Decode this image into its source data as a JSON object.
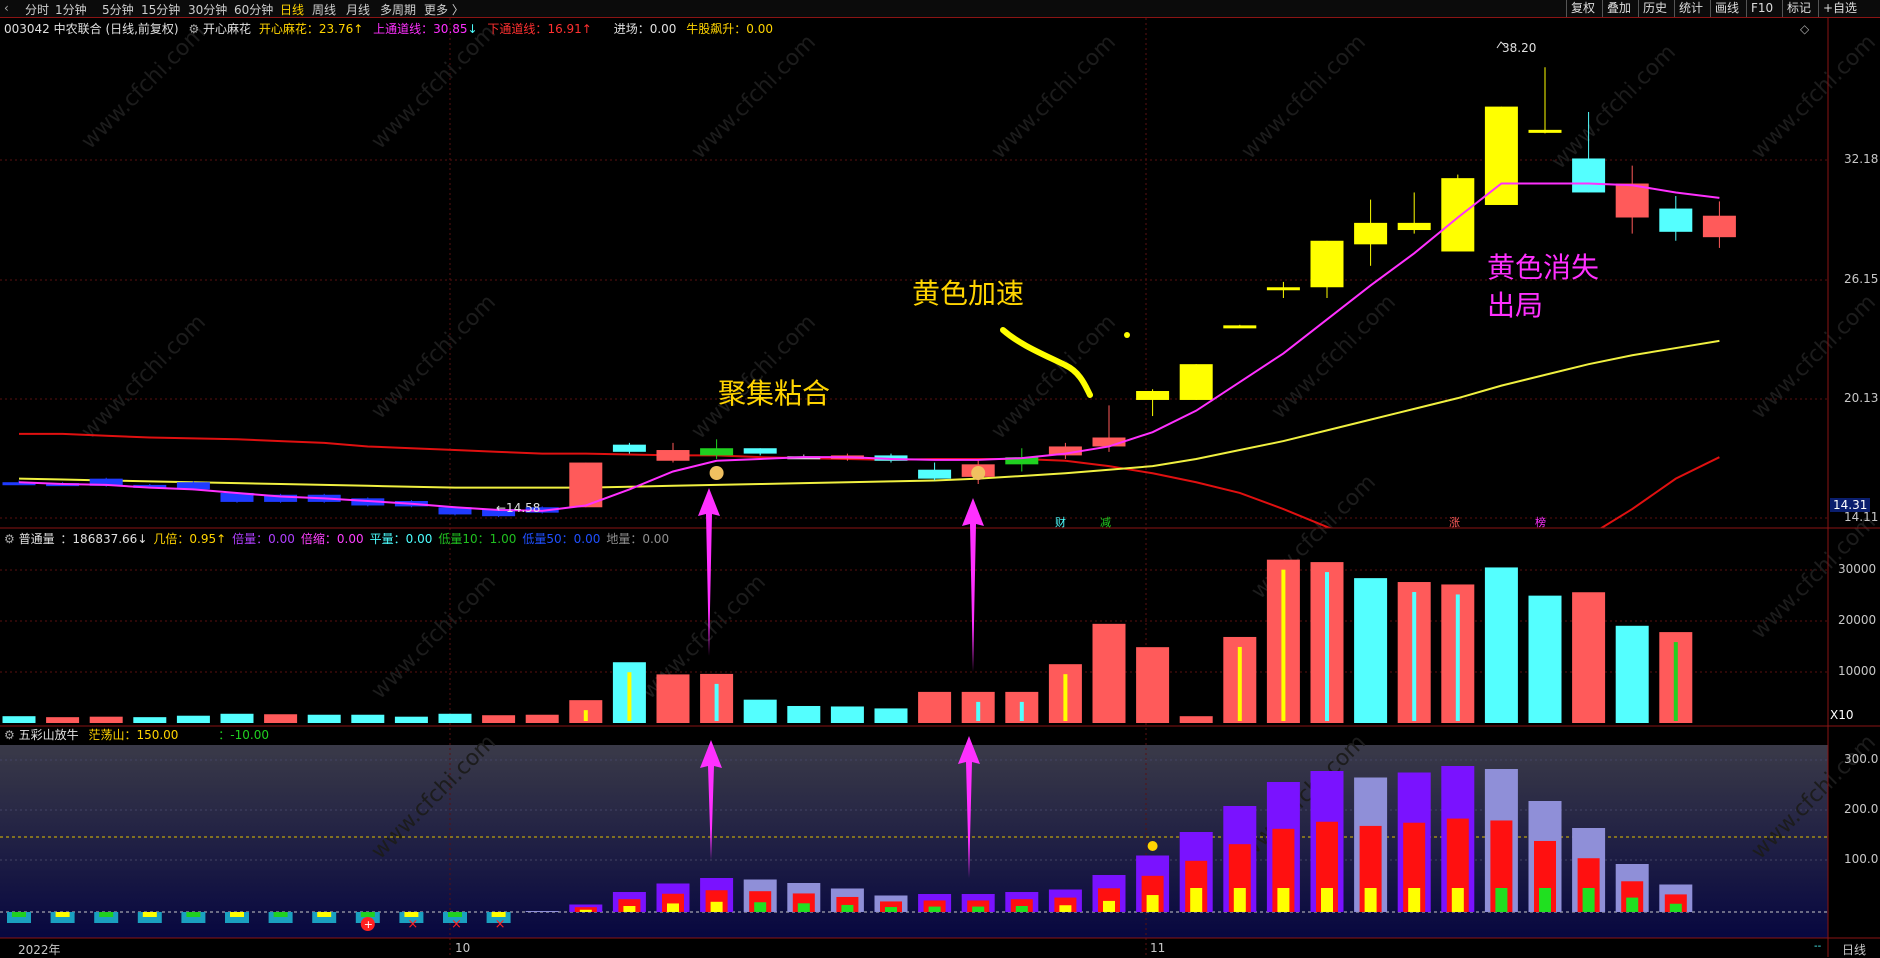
{
  "top_tabs": [
    "分时",
    "1分钟",
    "5分钟",
    "15分钟",
    "30分钟",
    "60分钟",
    "日线",
    "周线",
    "月线",
    "多周期",
    "更多 〉"
  ],
  "active_tab": "日线",
  "top_buttons": [
    "复权",
    "叠加",
    "历史",
    "统计",
    "画线",
    "F10",
    "标记",
    "+自选"
  ],
  "header": {
    "stock": "003042 中农联合 (日线,前复权)",
    "indicator_name": "开心麻花",
    "ind1_label": "开心麻花：",
    "ind1_value": "23.76",
    "ind1_arrow": "↑",
    "ind2_label": "上通道线：",
    "ind2_value": "30.85",
    "ind2_arrow": "↓",
    "ind3_label": "下通道线：",
    "ind3_value": "16.91",
    "ind3_arrow": "↑",
    "ind4_label": "进场：",
    "ind4_value": "0.00",
    "ind5_label": "牛股飙升：",
    "ind5_value": "0.00"
  },
  "volume_header": {
    "name": "普通量",
    "items": [
      {
        "label": "普通量：",
        "value": "186837.66",
        "arrow": "↓",
        "color": "#e0e0e0"
      },
      {
        "label": "几倍：",
        "value": "0.95",
        "arrow": "↑",
        "color": "#ffd400"
      },
      {
        "label": "倍量：",
        "value": "0.00",
        "arrow": "",
        "color": "#b040ff"
      },
      {
        "label": "倍缩：",
        "value": "0.00",
        "arrow": "",
        "color": "#ff40ff"
      },
      {
        "label": "平量：",
        "value": "0.00",
        "arrow": "",
        "color": "#4dffff"
      },
      {
        "label": "低量10：",
        "value": "1.00",
        "arrow": "",
        "color": "#20c020"
      },
      {
        "label": "低量50：",
        "value": "0.00",
        "arrow": "",
        "color": "#2050ff"
      },
      {
        "label": "地量：",
        "value": "0.00",
        "arrow": "",
        "color": "#909090"
      }
    ]
  },
  "lower_header": {
    "name": "五彩山放牛",
    "label1": "茫荡山：",
    "value1": "150.00",
    "label2": "：",
    "value2": "-10.00"
  },
  "price_axis": [
    "32.18",
    "26.15",
    "20.13",
    "14.11"
  ],
  "price_current": "14.31",
  "volume_axis": [
    "30000",
    "20000",
    "10000"
  ],
  "volume_unit": "X10",
  "lower_axis": [
    "300.0",
    "200.0",
    "100.0"
  ],
  "date_axis": [
    "2022年",
    "10",
    "11"
  ],
  "bottom_right": "日线",
  "annotations": {
    "juji": "聚集粘合",
    "jiasu": "黄色加速",
    "xiaoshi_1": "黄色消失",
    "xiaoshi_2": "出局"
  },
  "price_labels": {
    "high": "38.20",
    "low": "←14.58"
  },
  "event_markers": [
    "财",
    "减",
    "涨",
    "榜"
  ],
  "watermark": "www.cfchi.com",
  "colors": {
    "bull_red": "#ff5a5a",
    "bear_cyan": "#54ffff",
    "yellow": "#ffff00",
    "blue": "#1f3bff",
    "green": "#20d020",
    "magenta": "#ff30ff",
    "channel_red": "#e01010",
    "purple": "#7a12ff",
    "lavender": "#8f8fd8"
  },
  "chart_data": {
    "type": "candlestick",
    "count": 38,
    "candles": [
      {
        "o": 15.0,
        "c": 15.0,
        "h": 15.1,
        "l": 14.9,
        "col": "blue"
      },
      {
        "o": 14.95,
        "c": 14.95,
        "h": 15.0,
        "l": 14.9,
        "col": "blue"
      },
      {
        "o": 15.2,
        "c": 14.8,
        "h": 15.25,
        "l": 14.75,
        "col": "blue"
      },
      {
        "o": 14.85,
        "c": 14.85,
        "h": 14.9,
        "l": 14.8,
        "col": "blue"
      },
      {
        "o": 15.0,
        "c": 14.6,
        "h": 15.05,
        "l": 14.55,
        "col": "blue"
      },
      {
        "o": 14.4,
        "c": 13.9,
        "h": 14.45,
        "l": 13.85,
        "col": "blue"
      },
      {
        "o": 14.3,
        "c": 13.9,
        "h": 14.35,
        "l": 13.85,
        "col": "blue"
      },
      {
        "o": 14.3,
        "c": 13.9,
        "h": 14.35,
        "l": 13.85,
        "col": "blue"
      },
      {
        "o": 14.1,
        "c": 13.7,
        "h": 14.15,
        "l": 13.65,
        "col": "blue"
      },
      {
        "o": 13.95,
        "c": 13.65,
        "h": 14.0,
        "l": 13.6,
        "col": "blue"
      },
      {
        "o": 13.6,
        "c": 13.2,
        "h": 13.65,
        "l": 13.15,
        "col": "blue"
      },
      {
        "o": 13.5,
        "c": 13.1,
        "h": 13.55,
        "l": 13.05,
        "col": "blue"
      },
      {
        "o": 13.6,
        "c": 13.3,
        "h": 13.65,
        "l": 13.25,
        "col": "blue"
      },
      {
        "o": 13.6,
        "c": 16.1,
        "h": 16.1,
        "l": 13.6,
        "col": "red"
      },
      {
        "o": 17.1,
        "c": 16.7,
        "h": 17.2,
        "l": 16.6,
        "col": "cyan"
      },
      {
        "o": 16.2,
        "c": 16.8,
        "h": 17.2,
        "l": 16.1,
        "col": "red"
      },
      {
        "o": 16.5,
        "c": 16.9,
        "h": 17.4,
        "l": 16.3,
        "col": "green"
      },
      {
        "o": 16.9,
        "c": 16.6,
        "h": 16.9,
        "l": 16.5,
        "col": "cyan"
      },
      {
        "o": 16.45,
        "c": 16.45,
        "h": 16.55,
        "l": 16.35,
        "col": "white"
      },
      {
        "o": 16.3,
        "c": 16.5,
        "h": 16.6,
        "l": 16.2,
        "col": "red"
      },
      {
        "o": 16.5,
        "c": 16.2,
        "h": 16.6,
        "l": 16.1,
        "col": "cyan"
      },
      {
        "o": 15.7,
        "c": 15.2,
        "h": 16.1,
        "l": 15.1,
        "col": "cyan"
      },
      {
        "o": 15.3,
        "c": 16.0,
        "h": 16.3,
        "l": 14.9,
        "col": "red"
      },
      {
        "o": 16.0,
        "c": 16.4,
        "h": 16.9,
        "l": 15.6,
        "col": "green"
      },
      {
        "o": 16.5,
        "c": 17.0,
        "h": 17.2,
        "l": 16.3,
        "col": "red"
      },
      {
        "o": 17.0,
        "c": 17.5,
        "h": 19.3,
        "l": 16.7,
        "col": "red"
      },
      {
        "o": 19.6,
        "c": 20.1,
        "h": 20.2,
        "l": 18.7,
        "col": "yellow"
      },
      {
        "o": 19.6,
        "c": 21.6,
        "h": 21.6,
        "l": 19.6,
        "col": "yellow"
      },
      {
        "o": 23.77,
        "c": 23.77,
        "h": 23.8,
        "l": 23.7,
        "col": "yellow"
      },
      {
        "o": 25.9,
        "c": 25.9,
        "h": 26.2,
        "l": 25.3,
        "col": "yellow"
      },
      {
        "o": 25.9,
        "c": 28.5,
        "h": 28.5,
        "l": 25.3,
        "col": "yellow"
      },
      {
        "o": 28.3,
        "c": 29.5,
        "h": 30.8,
        "l": 27.1,
        "col": "yellow"
      },
      {
        "o": 29.1,
        "c": 29.5,
        "h": 31.2,
        "l": 28.9,
        "col": "yellow"
      },
      {
        "o": 27.9,
        "c": 32.0,
        "h": 32.2,
        "l": 27.9,
        "col": "yellow"
      },
      {
        "o": 30.5,
        "c": 36.0,
        "h": 36.0,
        "l": 30.5,
        "col": "yellow"
      },
      {
        "o": 34.7,
        "c": 34.7,
        "h": 38.2,
        "l": 34.5,
        "col": "yellow"
      },
      {
        "o": 33.1,
        "c": 31.2,
        "h": 35.7,
        "l": 31.2,
        "col": "cyan"
      },
      {
        "o": 29.8,
        "c": 31.7,
        "h": 32.7,
        "l": 28.9,
        "col": "red"
      },
      {
        "o": 29.0,
        "c": 30.3,
        "h": 31.0,
        "l": 28.5,
        "col": "cyan"
      },
      {
        "o": 28.7,
        "c": 29.9,
        "h": 30.7,
        "l": 28.1,
        "col": "red"
      }
    ],
    "magenta_line": [
      15.0,
      14.9,
      14.85,
      14.7,
      14.6,
      14.4,
      14.2,
      14.1,
      13.95,
      13.8,
      13.6,
      13.45,
      13.4,
      13.7,
      14.6,
      15.6,
      16.2,
      16.3,
      16.4,
      16.4,
      16.3,
      16.25,
      16.25,
      16.35,
      16.6,
      17.0,
      17.8,
      19.0,
      20.6,
      22.2,
      24.1,
      26.0,
      27.8,
      29.8,
      31.7,
      31.7,
      31.7,
      31.6,
      31.2,
      30.9
    ],
    "yellow_line": [
      15.2,
      15.15,
      15.1,
      15.05,
      15.0,
      14.95,
      14.9,
      14.85,
      14.8,
      14.75,
      14.7,
      14.7,
      14.7,
      14.7,
      14.75,
      14.8,
      14.85,
      14.9,
      14.95,
      15.0,
      15.05,
      15.1,
      15.2,
      15.35,
      15.5,
      15.7,
      15.9,
      16.3,
      16.8,
      17.3,
      17.9,
      18.5,
      19.1,
      19.7,
      20.4,
      21.0,
      21.6,
      22.1,
      22.5,
      22.9
    ],
    "red_line": [
      17.7,
      17.7,
      17.6,
      17.5,
      17.45,
      17.4,
      17.3,
      17.2,
      17.0,
      16.9,
      16.8,
      16.7,
      16.6,
      16.6,
      16.55,
      16.5,
      16.5,
      16.4,
      16.35,
      16.3,
      16.25,
      16.3,
      16.3,
      16.3,
      16.2,
      15.9,
      15.5,
      15.0,
      14.4,
      13.5,
      12.5,
      11.5,
      10.5,
      10.0,
      10.0,
      10.8,
      12.0,
      13.5,
      15.2,
      16.4
    ],
    "volume": [
      {
        "v": 1400,
        "col": "cyan",
        "inner": "green"
      },
      {
        "v": 1200,
        "col": "red"
      },
      {
        "v": 1300,
        "col": "red"
      },
      {
        "v": 1200,
        "col": "cyan"
      },
      {
        "v": 1500,
        "col": "cyan"
      },
      {
        "v": 1900,
        "col": "cyan"
      },
      {
        "v": 1800,
        "col": "red"
      },
      {
        "v": 1700,
        "col": "cyan"
      },
      {
        "v": 1700,
        "col": "cyan"
      },
      {
        "v": 1300,
        "col": "cyan"
      },
      {
        "v": 1900,
        "col": "cyan"
      },
      {
        "v": 1600,
        "col": "red"
      },
      {
        "v": 1700,
        "col": "red"
      },
      {
        "v": 4700,
        "col": "red",
        "inner": "yellow"
      },
      {
        "v": 12500,
        "col": "cyan",
        "inner": "yellow"
      },
      {
        "v": 10000,
        "col": "red"
      },
      {
        "v": 10100,
        "col": "red",
        "inner": "cyan"
      },
      {
        "v": 4800,
        "col": "cyan"
      },
      {
        "v": 3500,
        "col": "cyan"
      },
      {
        "v": 3400,
        "col": "cyan"
      },
      {
        "v": 3000,
        "col": "cyan"
      },
      {
        "v": 6400,
        "col": "red"
      },
      {
        "v": 6400,
        "col": "red",
        "inner": "cyan"
      },
      {
        "v": 6400,
        "col": "red",
        "inner": "cyan"
      },
      {
        "v": 12100,
        "col": "red",
        "inner": "yellow"
      },
      {
        "v": 20400,
        "col": "red"
      },
      {
        "v": 15600,
        "col": "red"
      },
      {
        "v": 1400,
        "col": "red"
      },
      {
        "v": 17700,
        "col": "red",
        "inner": "yellow"
      },
      {
        "v": 33600,
        "col": "red",
        "inner": "yellow"
      },
      {
        "v": 33100,
        "col": "red",
        "inner": "cyan"
      },
      {
        "v": 29800,
        "col": "cyan"
      },
      {
        "v": 29000,
        "col": "red",
        "inner": "cyan"
      },
      {
        "v": 28500,
        "col": "red",
        "inner": "cyan"
      },
      {
        "v": 32000,
        "col": "cyan"
      },
      {
        "v": 26200,
        "col": "cyan"
      },
      {
        "v": 26900,
        "col": "red"
      },
      {
        "v": 20000,
        "col": "cyan"
      },
      {
        "v": 18700,
        "col": "red",
        "inner": "green"
      }
    ],
    "lower_bars": [
      {
        "v": -10,
        "outer": "cyan"
      },
      {
        "v": -10,
        "outer": "cyan"
      },
      {
        "v": -10,
        "outer": "cyan"
      },
      {
        "v": -10,
        "outer": "cyan"
      },
      {
        "v": -10,
        "outer": "cyan"
      },
      {
        "v": -10,
        "outer": "cyan"
      },
      {
        "v": -10,
        "outer": "cyan"
      },
      {
        "v": -10,
        "outer": "cyan"
      },
      {
        "v": -10,
        "outer": "cyan"
      },
      {
        "v": -10,
        "outer": "cyan"
      },
      {
        "v": -10,
        "outer": "cyan"
      },
      {
        "v": -10,
        "outer": "cyan"
      },
      {
        "v": 2,
        "outer": "lavender"
      },
      {
        "v": 15,
        "outer": "purple"
      },
      {
        "v": 40,
        "outer": "purple"
      },
      {
        "v": 57,
        "outer": "purple"
      },
      {
        "v": 68,
        "outer": "purple"
      },
      {
        "v": 65,
        "outer": "lavender"
      },
      {
        "v": 58,
        "outer": "lavender"
      },
      {
        "v": 47,
        "outer": "lavender"
      },
      {
        "v": 33,
        "outer": "lavender"
      },
      {
        "v": 36,
        "outer": "purple"
      },
      {
        "v": 36,
        "outer": "purple"
      },
      {
        "v": 40,
        "outer": "purple"
      },
      {
        "v": 45,
        "outer": "purple"
      },
      {
        "v": 74,
        "outer": "purple"
      },
      {
        "v": 113,
        "outer": "purple"
      },
      {
        "v": 160,
        "outer": "purple"
      },
      {
        "v": 212,
        "outer": "purple"
      },
      {
        "v": 260,
        "outer": "purple"
      },
      {
        "v": 282,
        "outer": "purple"
      },
      {
        "v": 269,
        "outer": "lavender"
      },
      {
        "v": 279,
        "outer": "purple"
      },
      {
        "v": 292,
        "outer": "purple"
      },
      {
        "v": 286,
        "outer": "lavender"
      },
      {
        "v": 222,
        "outer": "lavender"
      },
      {
        "v": 168,
        "outer": "lavender"
      },
      {
        "v": 96,
        "outer": "lavender"
      },
      {
        "v": 55,
        "outer": "lavender"
      }
    ],
    "lower_lines": {
      "upper": 150,
      "zero": 0,
      "lower": -10
    }
  }
}
